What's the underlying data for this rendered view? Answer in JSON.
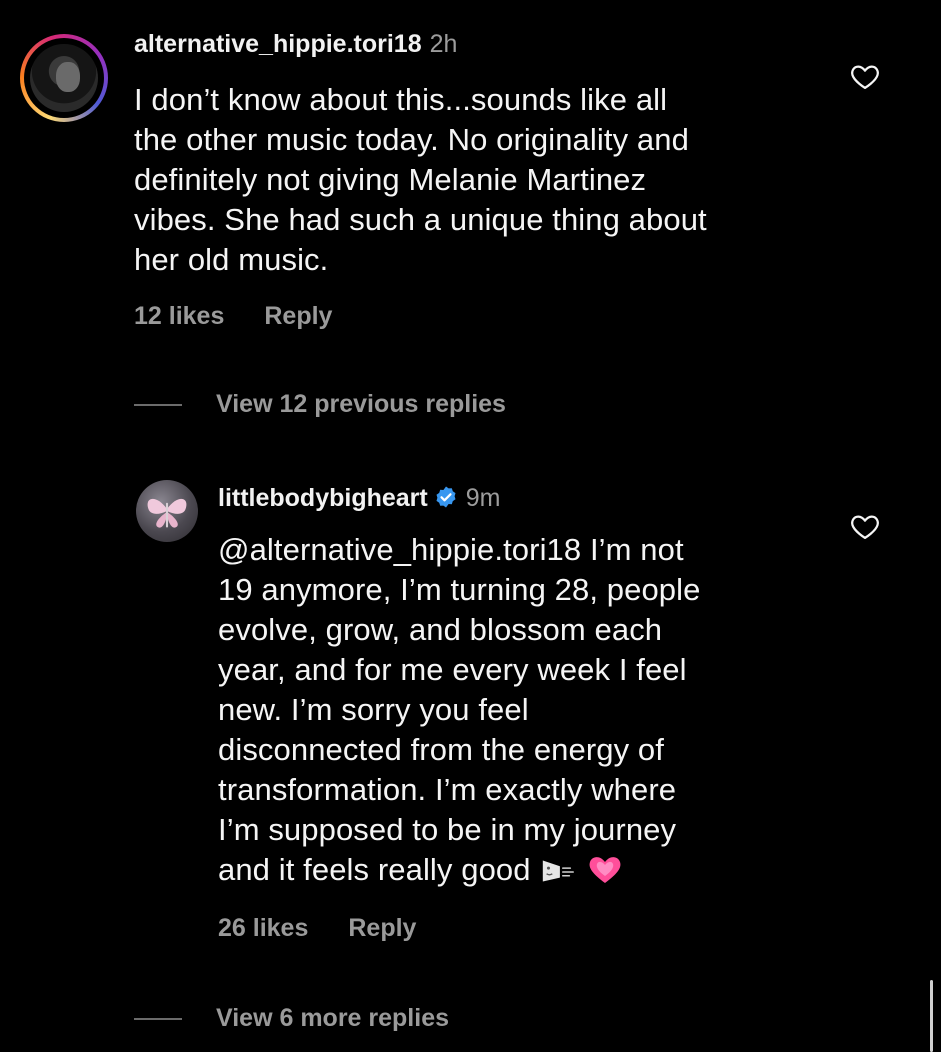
{
  "comments": [
    {
      "username": "alternative_hippie.tori18",
      "time": "2h",
      "lines": [
        "I don’t know about this...sounds like all",
        "the other music today. No originality and",
        "definitely not giving Melanie Martinez",
        "vibes. She had such a unique thing about",
        "her old music."
      ],
      "likes": "12 likes",
      "reply": "Reply",
      "avatar_icon": "avatar-with-story-ring",
      "view_replies": "View 12 previous replies"
    },
    {
      "username": "littlebodybigheart",
      "time": "9m",
      "verified": true,
      "lines": [
        "@alternative_hippie.tori18 I’m not",
        "19 anymore, I’m turning 28, people",
        "evolve, grow, and blossom each",
        "year, and for me every week I feel",
        "new. I’m sorry you feel",
        "disconnected from the energy of",
        "transformation. I’m exactly where",
        "I’m supposed to be in my journey",
        "and it feels really good"
      ],
      "likes": "26 likes",
      "reply": "Reply",
      "avatar_icon": "butterfly-avatar",
      "emojis": [
        "wind-face-emoji",
        "growing-heart-emoji"
      ],
      "view_replies": "View 6 more replies"
    }
  ],
  "colors": {
    "background": "#000000",
    "text": "#f5f5f5",
    "muted": "#9a9a9a",
    "verified": "#3897f0",
    "heart_emoji": "#ff4f9a"
  }
}
